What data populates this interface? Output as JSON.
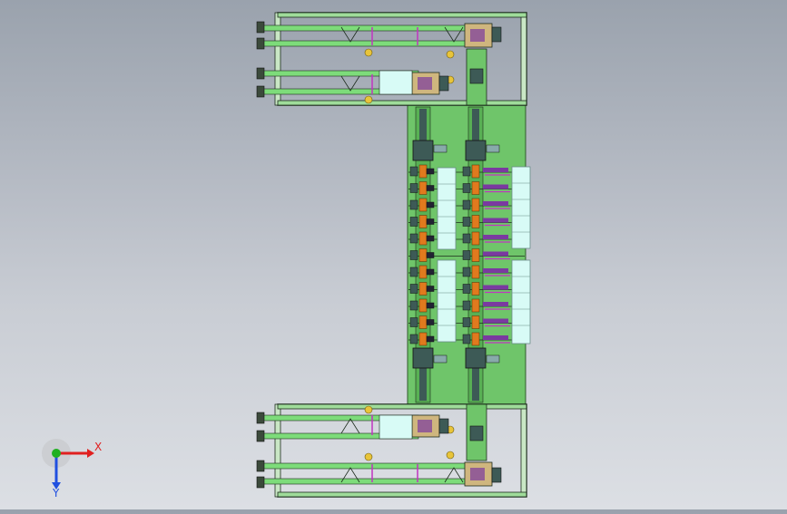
{
  "scene": {
    "colors": {
      "background_top": "#9aa2ad",
      "background_bottom": "#dcdfe4",
      "plate": "#6fc56a",
      "plate_edge": "#2f5a2a",
      "rail": "#7ddc7a",
      "frame_line": "#1c2b1c",
      "cyan_panel": "#d8fbf6",
      "orange_part": "#e07a1e",
      "motor": "#3d5a56",
      "magenta": "#c035c0",
      "purple": "#7a3aa0",
      "yellow_roller": "#e8c43a",
      "tan_block": "#cfb67e"
    },
    "icons": [
      "coordinate-triad-icon"
    ]
  },
  "triad": {
    "x_label": "X",
    "y_label": "Y",
    "x_color": "#e02020",
    "y_color": "#2050e0",
    "z_color": "#20b020"
  }
}
